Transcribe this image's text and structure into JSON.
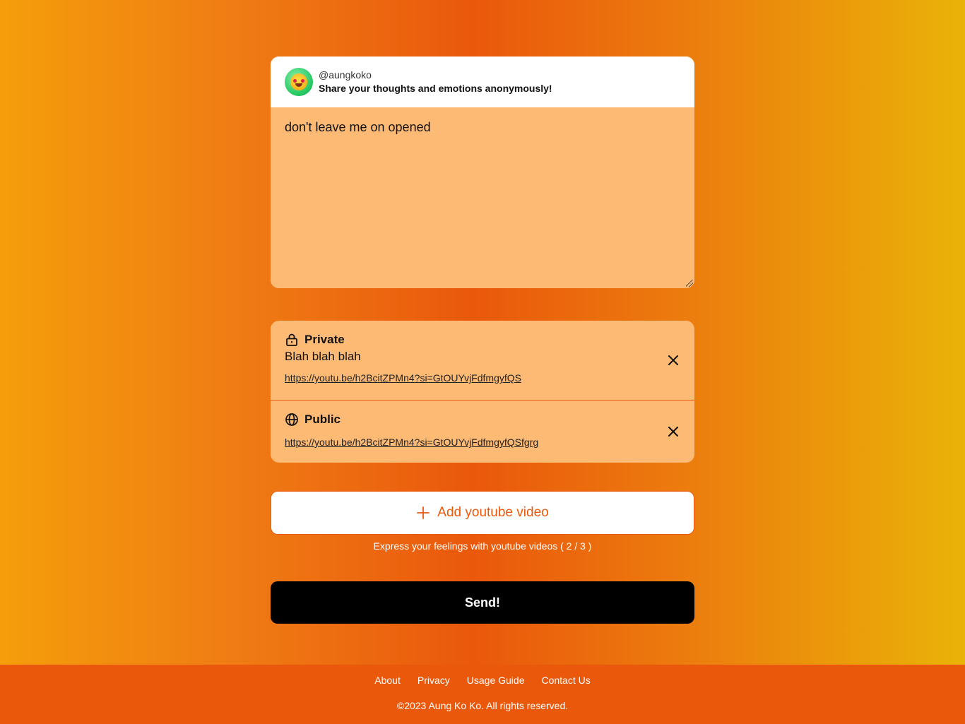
{
  "profile": {
    "username": "@aungkoko",
    "tagline": "Share your thoughts and emotions anonymously!",
    "avatar_icon": "smiling-face-avatar"
  },
  "message": {
    "value": "don't leave me on opened"
  },
  "videos": [
    {
      "visibility": "Private",
      "icon": "lock-icon",
      "note": "Blah blah blah",
      "url": "https://youtu.be/h2BcitZPMn4?si=GtOUYvjFdfmgyfQS"
    },
    {
      "visibility": "Public",
      "icon": "globe-icon",
      "url": "https://youtu.be/h2BcitZPMn4?si=GtOUYvjFdfmgyfQSfgrg"
    }
  ],
  "add_video": {
    "label": "Add youtube video",
    "hint": "Express your feelings with youtube videos ( 2 / 3 )"
  },
  "send": {
    "label": "Send!"
  },
  "footer": {
    "links": [
      "About",
      "Privacy",
      "Usage Guide",
      "Contact Us"
    ],
    "copyright": "©2023 Aung Ko Ko. All rights reserved."
  },
  "colors": {
    "accent": "#ea580c",
    "panel": "#fdba74",
    "button_dark": "#000000"
  }
}
